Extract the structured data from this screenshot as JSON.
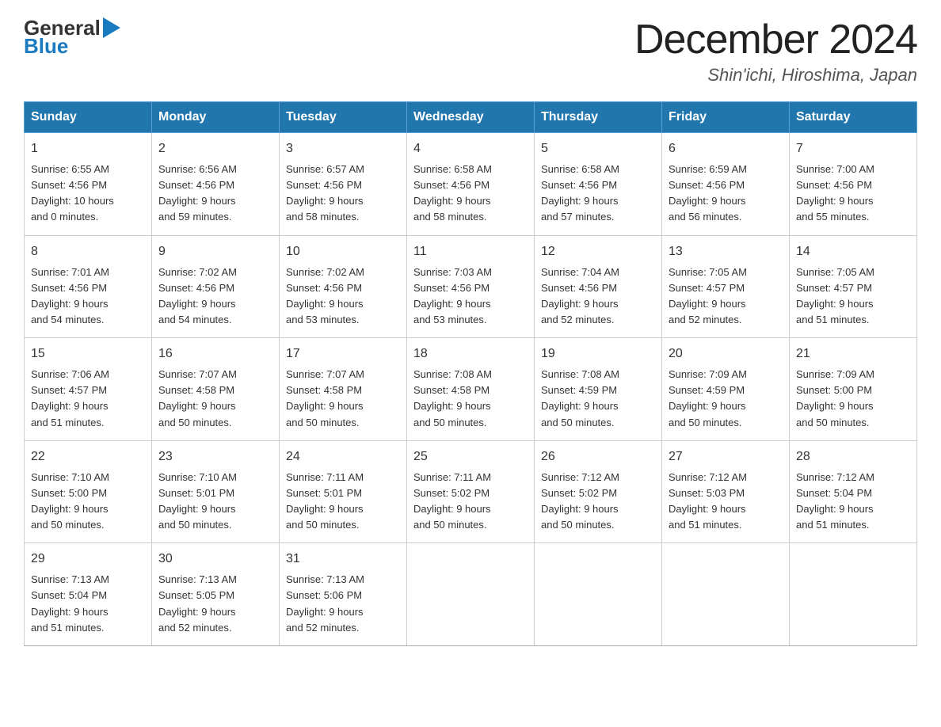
{
  "header": {
    "logo": {
      "text_general": "General",
      "text_blue": "Blue"
    },
    "month_title": "December 2024",
    "location": "Shin'ichi, Hiroshima, Japan"
  },
  "calendar": {
    "days_of_week": [
      "Sunday",
      "Monday",
      "Tuesday",
      "Wednesday",
      "Thursday",
      "Friday",
      "Saturday"
    ],
    "weeks": [
      [
        {
          "day": "1",
          "sunrise": "6:55 AM",
          "sunset": "4:56 PM",
          "daylight": "10 hours and 0 minutes."
        },
        {
          "day": "2",
          "sunrise": "6:56 AM",
          "sunset": "4:56 PM",
          "daylight": "9 hours and 59 minutes."
        },
        {
          "day": "3",
          "sunrise": "6:57 AM",
          "sunset": "4:56 PM",
          "daylight": "9 hours and 58 minutes."
        },
        {
          "day": "4",
          "sunrise": "6:58 AM",
          "sunset": "4:56 PM",
          "daylight": "9 hours and 58 minutes."
        },
        {
          "day": "5",
          "sunrise": "6:58 AM",
          "sunset": "4:56 PM",
          "daylight": "9 hours and 57 minutes."
        },
        {
          "day": "6",
          "sunrise": "6:59 AM",
          "sunset": "4:56 PM",
          "daylight": "9 hours and 56 minutes."
        },
        {
          "day": "7",
          "sunrise": "7:00 AM",
          "sunset": "4:56 PM",
          "daylight": "9 hours and 55 minutes."
        }
      ],
      [
        {
          "day": "8",
          "sunrise": "7:01 AM",
          "sunset": "4:56 PM",
          "daylight": "9 hours and 54 minutes."
        },
        {
          "day": "9",
          "sunrise": "7:02 AM",
          "sunset": "4:56 PM",
          "daylight": "9 hours and 54 minutes."
        },
        {
          "day": "10",
          "sunrise": "7:02 AM",
          "sunset": "4:56 PM",
          "daylight": "9 hours and 53 minutes."
        },
        {
          "day": "11",
          "sunrise": "7:03 AM",
          "sunset": "4:56 PM",
          "daylight": "9 hours and 53 minutes."
        },
        {
          "day": "12",
          "sunrise": "7:04 AM",
          "sunset": "4:56 PM",
          "daylight": "9 hours and 52 minutes."
        },
        {
          "day": "13",
          "sunrise": "7:05 AM",
          "sunset": "4:57 PM",
          "daylight": "9 hours and 52 minutes."
        },
        {
          "day": "14",
          "sunrise": "7:05 AM",
          "sunset": "4:57 PM",
          "daylight": "9 hours and 51 minutes."
        }
      ],
      [
        {
          "day": "15",
          "sunrise": "7:06 AM",
          "sunset": "4:57 PM",
          "daylight": "9 hours and 51 minutes."
        },
        {
          "day": "16",
          "sunrise": "7:07 AM",
          "sunset": "4:58 PM",
          "daylight": "9 hours and 50 minutes."
        },
        {
          "day": "17",
          "sunrise": "7:07 AM",
          "sunset": "4:58 PM",
          "daylight": "9 hours and 50 minutes."
        },
        {
          "day": "18",
          "sunrise": "7:08 AM",
          "sunset": "4:58 PM",
          "daylight": "9 hours and 50 minutes."
        },
        {
          "day": "19",
          "sunrise": "7:08 AM",
          "sunset": "4:59 PM",
          "daylight": "9 hours and 50 minutes."
        },
        {
          "day": "20",
          "sunrise": "7:09 AM",
          "sunset": "4:59 PM",
          "daylight": "9 hours and 50 minutes."
        },
        {
          "day": "21",
          "sunrise": "7:09 AM",
          "sunset": "5:00 PM",
          "daylight": "9 hours and 50 minutes."
        }
      ],
      [
        {
          "day": "22",
          "sunrise": "7:10 AM",
          "sunset": "5:00 PM",
          "daylight": "9 hours and 50 minutes."
        },
        {
          "day": "23",
          "sunrise": "7:10 AM",
          "sunset": "5:01 PM",
          "daylight": "9 hours and 50 minutes."
        },
        {
          "day": "24",
          "sunrise": "7:11 AM",
          "sunset": "5:01 PM",
          "daylight": "9 hours and 50 minutes."
        },
        {
          "day": "25",
          "sunrise": "7:11 AM",
          "sunset": "5:02 PM",
          "daylight": "9 hours and 50 minutes."
        },
        {
          "day": "26",
          "sunrise": "7:12 AM",
          "sunset": "5:02 PM",
          "daylight": "9 hours and 50 minutes."
        },
        {
          "day": "27",
          "sunrise": "7:12 AM",
          "sunset": "5:03 PM",
          "daylight": "9 hours and 51 minutes."
        },
        {
          "day": "28",
          "sunrise": "7:12 AM",
          "sunset": "5:04 PM",
          "daylight": "9 hours and 51 minutes."
        }
      ],
      [
        {
          "day": "29",
          "sunrise": "7:13 AM",
          "sunset": "5:04 PM",
          "daylight": "9 hours and 51 minutes."
        },
        {
          "day": "30",
          "sunrise": "7:13 AM",
          "sunset": "5:05 PM",
          "daylight": "9 hours and 52 minutes."
        },
        {
          "day": "31",
          "sunrise": "7:13 AM",
          "sunset": "5:06 PM",
          "daylight": "9 hours and 52 minutes."
        },
        null,
        null,
        null,
        null
      ]
    ],
    "labels": {
      "sunrise": "Sunrise: ",
      "sunset": "Sunset: ",
      "daylight": "Daylight: "
    }
  }
}
